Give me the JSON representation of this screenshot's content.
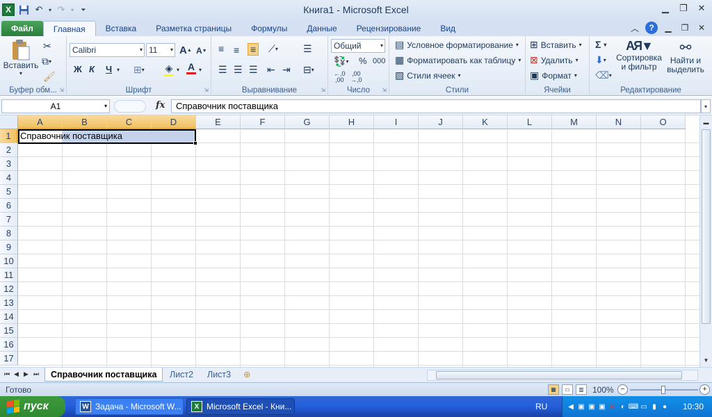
{
  "window": {
    "title": "Книга1  -  Microsoft Excel"
  },
  "ribbon_tabs": {
    "file": "Файл",
    "home": "Главная",
    "insert": "Вставка",
    "page_layout": "Разметка страницы",
    "formulas": "Формулы",
    "data": "Данные",
    "review": "Рецензирование",
    "view": "Вид"
  },
  "clipboard": {
    "paste_label": "Вставить",
    "group_label": "Буфер обм..."
  },
  "font": {
    "family": "Calibri",
    "size": "11",
    "bold": "Ж",
    "italic": "К",
    "underline": "Ч",
    "grow": "A",
    "shrink": "A",
    "group_label": "Шрифт"
  },
  "alignment": {
    "group_label": "Выравнивание"
  },
  "number": {
    "format": "Общий",
    "percent": "%",
    "thousands": "000",
    "group_label": "Число"
  },
  "styles": {
    "conditional": "Условное форматирование",
    "as_table": "Форматировать как таблицу",
    "cell_styles": "Стили ячеек",
    "group_label": "Стили"
  },
  "cells": {
    "insert": "Вставить",
    "delete": "Удалить",
    "format": "Формат",
    "group_label": "Ячейки"
  },
  "editing": {
    "sum": "Σ",
    "sort_line1": "Сортировка",
    "sort_line2": "и фильтр",
    "find_line1": "Найти и",
    "find_line2": "выделить",
    "group_label": "Редактирование"
  },
  "formula_bar": {
    "name_box": "A1",
    "fx": "fx",
    "content": "Справочник поставщика"
  },
  "grid": {
    "columns": [
      "A",
      "B",
      "C",
      "D",
      "E",
      "F",
      "G",
      "H",
      "I",
      "J",
      "K",
      "L",
      "M",
      "N",
      "O"
    ],
    "rows": [
      "1",
      "2",
      "3",
      "4",
      "5",
      "6",
      "7",
      "8",
      "9",
      "10",
      "11",
      "12",
      "13",
      "14",
      "15",
      "16",
      "17"
    ],
    "a1": "Справочник поставщика"
  },
  "sheets": {
    "sheet1": "Справочник поставщика",
    "sheet2": "Лист2",
    "sheet3": "Лист3"
  },
  "status": {
    "ready": "Готово",
    "zoom": "100%"
  },
  "taskbar": {
    "start": "пуск",
    "item_word": "Задача - Microsoft W...",
    "item_excel": "Microsoft Excel - Кни...",
    "lang": "RU",
    "clock": "10:30"
  },
  "colors": {
    "ribbon": "#dfe9f5",
    "selection_header": "#f1c15f",
    "selection_fill": "#c5d3ea",
    "taskbar": "#245edb",
    "start": "#2f8a2f"
  }
}
